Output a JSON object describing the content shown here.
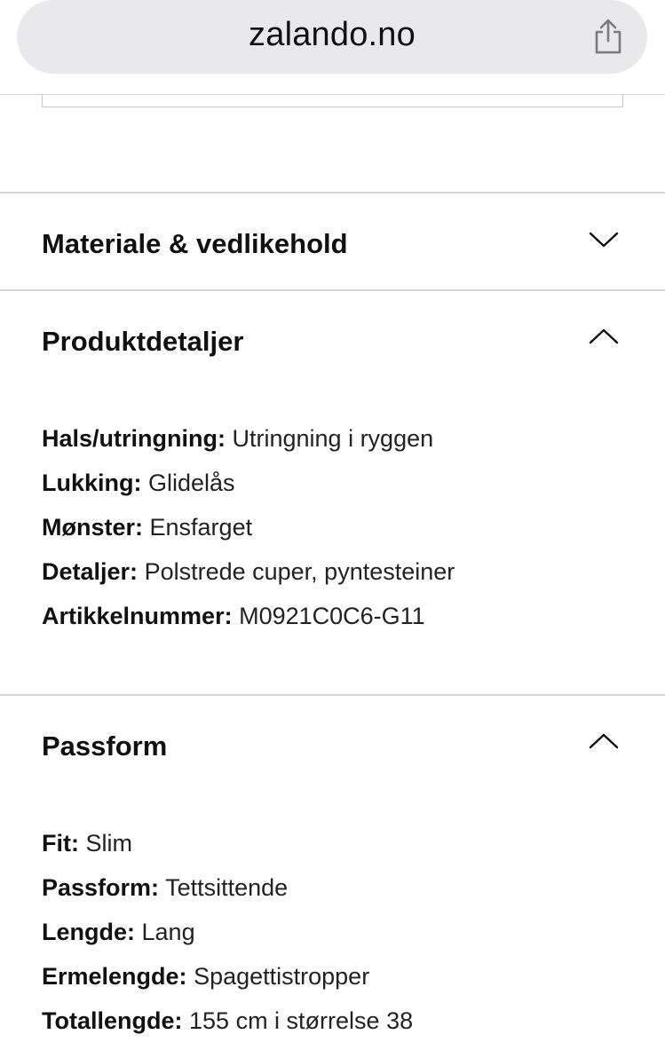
{
  "browser": {
    "url": "zalando.no"
  },
  "sections": {
    "materiale": {
      "title": "Materiale & vedlikehold",
      "state": "collapsed"
    },
    "produktdetaljer": {
      "title": "Produktdetaljer",
      "state": "expanded",
      "rows": [
        {
          "label": "Hals/utringning:",
          "value": "Utringning i ryggen"
        },
        {
          "label": "Lukking:",
          "value": "Glidelås"
        },
        {
          "label": "Mønster:",
          "value": "Ensfarget"
        },
        {
          "label": "Detaljer:",
          "value": "Polstrede cuper, pyntesteiner"
        },
        {
          "label": "Artikkelnummer:",
          "value": "M0921C0C6-G11"
        }
      ]
    },
    "passform": {
      "title": "Passform",
      "state": "expanded",
      "rows": [
        {
          "label": "Fit:",
          "value": "Slim"
        },
        {
          "label": "Passform:",
          "value": "Tettsittende"
        },
        {
          "label": "Lengde:",
          "value": "Lang"
        },
        {
          "label": "Ermelengde:",
          "value": "Spagettistropper"
        },
        {
          "label": "Totallengde:",
          "value": "155 cm i størrelse 38"
        }
      ]
    }
  },
  "icons": {
    "share": "share-icon",
    "collapsed": "chevron-down-icon",
    "expanded": "chevron-up-icon"
  }
}
